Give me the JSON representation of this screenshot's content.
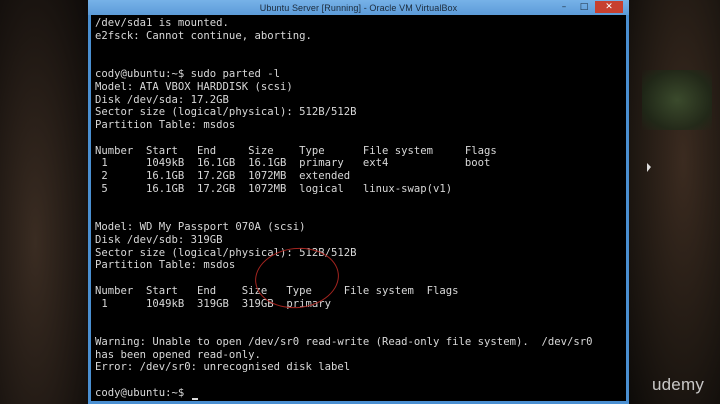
{
  "window": {
    "title": "Ubuntu Server [Running] - Oracle VM VirtualBox",
    "controls": {
      "minimize": "–",
      "maximize": "□",
      "close": "✕"
    }
  },
  "terminal": {
    "lines": [
      "/dev/sda1 is mounted.",
      "e2fsck: Cannot continue, aborting.",
      "",
      "",
      "cody@ubuntu:~$ sudo parted -l",
      "Model: ATA VBOX HARDDISK (scsi)",
      "Disk /dev/sda: 17.2GB",
      "Sector size (logical/physical): 512B/512B",
      "Partition Table: msdos",
      "",
      "Number  Start   End     Size    Type      File system     Flags",
      " 1      1049kB  16.1GB  16.1GB  primary   ext4            boot",
      " 2      16.1GB  17.2GB  1072MB  extended",
      " 5      16.1GB  17.2GB  1072MB  logical   linux-swap(v1)",
      "",
      "",
      "Model: WD My Passport 070A (scsi)",
      "Disk /dev/sdb: 319GB",
      "Sector size (logical/physical): 512B/512B",
      "Partition Table: msdos",
      "",
      "Number  Start   End    Size   Type     File system  Flags",
      " 1      1049kB  319GB  319GB  primary",
      "",
      "",
      "Warning: Unable to open /dev/sr0 read-write (Read-only file system).  /dev/sr0",
      "has been opened read-only.",
      "Error: /dev/sr0: unrecognised disk label",
      "",
      "cody@ubuntu:~$ "
    ]
  },
  "watermark": "udemy",
  "colors": {
    "annotation": "#a3241f",
    "terminal_text": "#d8d8d8",
    "titlebar": "#5c9bd8"
  }
}
